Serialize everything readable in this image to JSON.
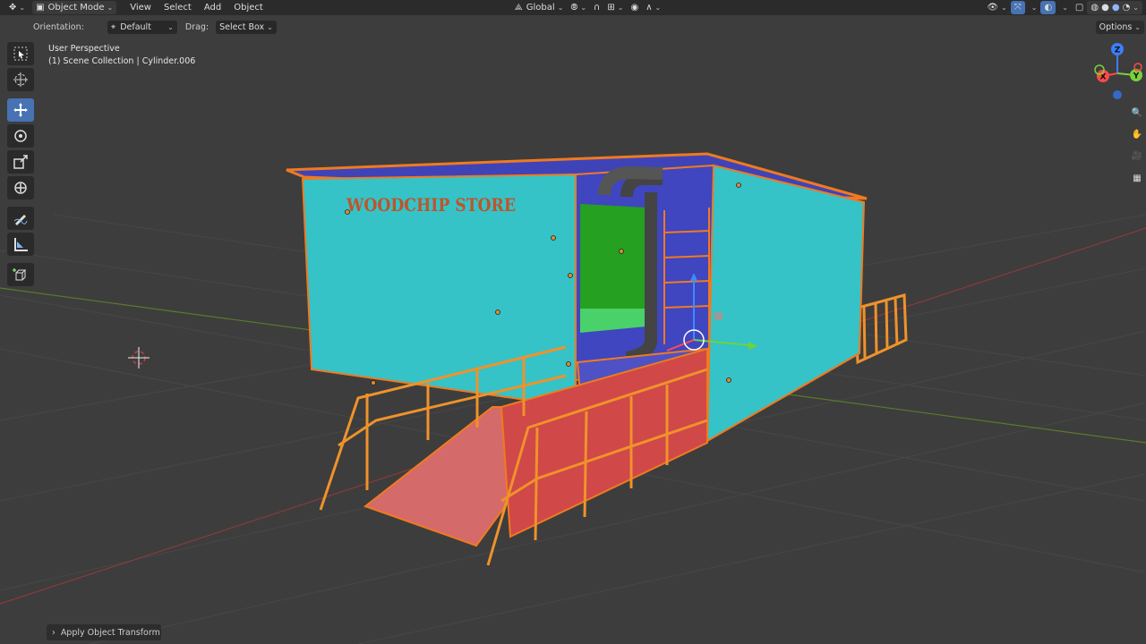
{
  "header": {
    "mode": "Object Mode",
    "menus": [
      "View",
      "Select",
      "Add",
      "Object"
    ],
    "transform_orientation": "Global",
    "options_label": "Options"
  },
  "tool_settings": {
    "orientation_label": "Orientation:",
    "orientation_value": "Default",
    "drag_label": "Drag:",
    "drag_value": "Select Box"
  },
  "viewport": {
    "perspective": "User Perspective",
    "collection_info": "(1) Scene Collection | Cylinder.006",
    "sign_text": "WOODCHIP STORE"
  },
  "gizmo": {
    "z": "Z",
    "x": "X",
    "y": "Y"
  },
  "toolbar": {
    "tools": [
      "select-box-tool",
      "cursor-tool",
      "move-tool",
      "rotate-tool",
      "scale-tool",
      "transform-tool",
      "annotate-tool",
      "measure-tool",
      "add-cube-tool"
    ],
    "active": "move-tool"
  },
  "last_operator": "Apply Object Transform",
  "colors": {
    "background": "#3d3d3d",
    "wall": "#2ec4c6",
    "ramp": "#d65a5a",
    "outline": "#f07a1f",
    "active_tool": "#4772b3"
  }
}
